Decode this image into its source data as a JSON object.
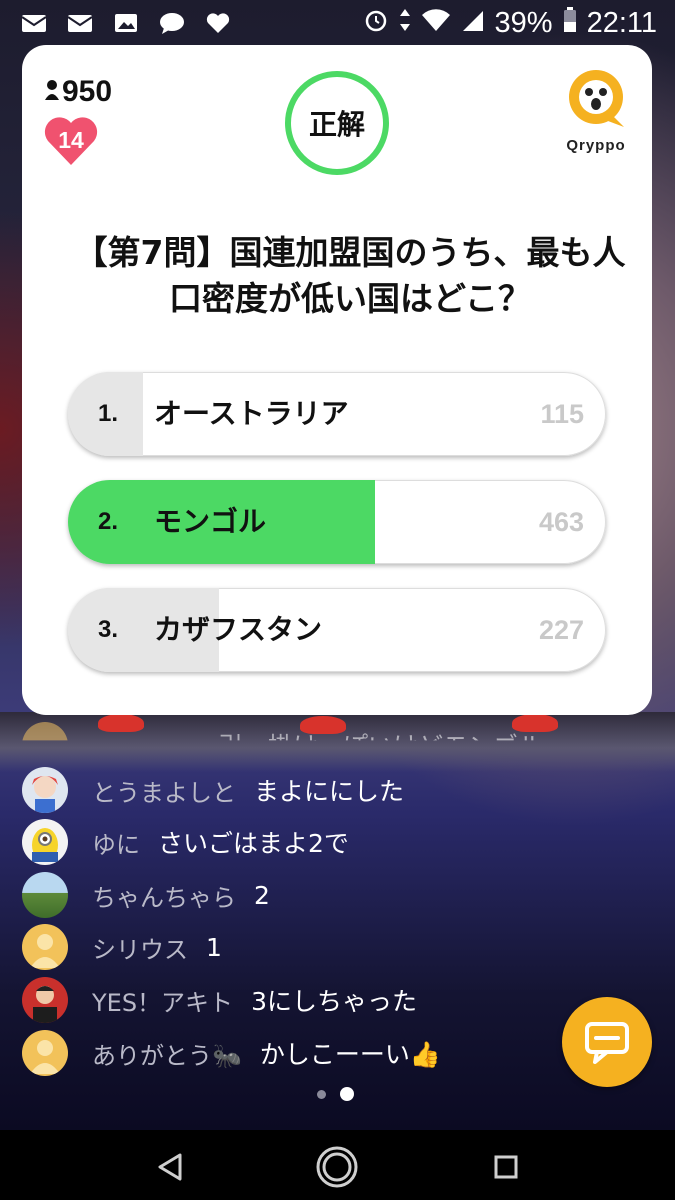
{
  "status_bar": {
    "battery": "39%",
    "time": "22:11",
    "icons": [
      "mail-icon",
      "mail-icon",
      "image-icon",
      "chat-bubble-icon",
      "heart-icon",
      "alarm-icon",
      "data-arrows-icon",
      "wifi-icon",
      "signal-icon",
      "battery-icon"
    ]
  },
  "quiz": {
    "viewer_count": "950",
    "hearts": "14",
    "result_label": "正解",
    "logo_text": "Qryppo",
    "question": "【第7問】国連加盟国のうち、最も人口密度が低い国はどこ？",
    "options": [
      {
        "number": "1.",
        "label": "オーストラリア",
        "count": "115",
        "correct": false,
        "fill_fraction": 0.14
      },
      {
        "number": "2.",
        "label": "モンゴル",
        "count": "463",
        "correct": true,
        "fill_fraction": 0.57
      },
      {
        "number": "3.",
        "label": "カザフスタン",
        "count": "227",
        "correct": false,
        "fill_fraction": 0.28
      }
    ],
    "colors": {
      "correct": "#4cd964",
      "other": "#e6e6e6",
      "ring": "#4cd964",
      "brand": "#f5b120"
    }
  },
  "comments": [
    {
      "name": "ゆに",
      "text": "さいごはまよ2で",
      "avatar": "minion-avatar"
    },
    {
      "name": "とうまよしと",
      "text": "まよににした",
      "avatar": "anime-avatar"
    },
    {
      "name": "ちゃんちゃら",
      "text": "2",
      "avatar": "landscape-avatar"
    },
    {
      "name": "シリウス",
      "text": "1",
      "avatar": "default-avatar"
    },
    {
      "name": "YES！アキト",
      "text": "3にしちゃった",
      "avatar": "person-avatar"
    },
    {
      "name": "ありがとう🐜",
      "text": "かしこーーい👍",
      "avatar": "default-avatar"
    }
  ],
  "partial_comment": "引っ掛けっぽいけどモンゴル",
  "pager": {
    "pages": 2,
    "active": 2
  }
}
